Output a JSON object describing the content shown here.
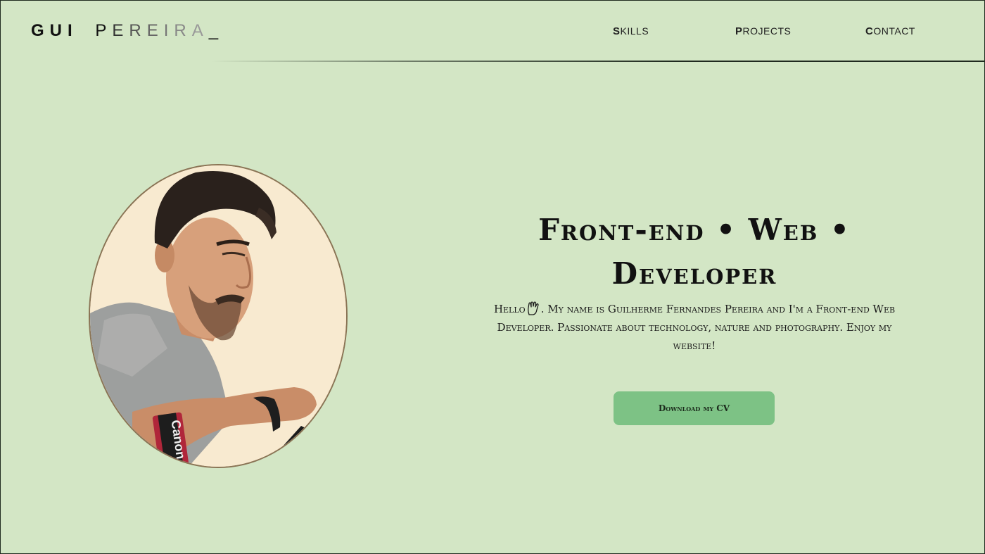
{
  "header": {
    "logo_first": "GUI",
    "logo_last": "PEREIRA",
    "logo_cursor": "_",
    "nav": [
      {
        "cap": "S",
        "rest": "KILLS"
      },
      {
        "cap": "P",
        "rest": "ROJECTS"
      },
      {
        "cap": "C",
        "rest": "ONTACT"
      }
    ]
  },
  "hero": {
    "title_line1": "Front-end • Web •",
    "title_line2": "Developer",
    "desc_before_icon": "Hello",
    "desc_after_icon": ". My name is Guilherme Fernandes Pereira and I'm a Front-end Web Developer. Passionate about technology, nature and photography. Enjoy my website!",
    "wave_icon": "vulcan-salute-icon",
    "cv_button_label": "Download my CV"
  },
  "portrait": {
    "icon": "profile-photo",
    "camera_strap_text": "Canon"
  },
  "colors": {
    "background": "#d3e6c5",
    "button": "#7dc285",
    "portrait_bg": "#f8ead0",
    "portrait_border": "#8a7455"
  }
}
